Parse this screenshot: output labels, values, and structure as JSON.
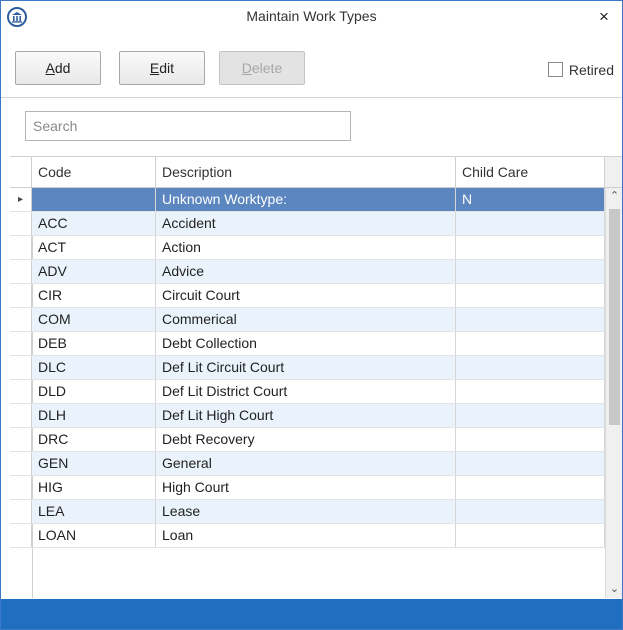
{
  "window": {
    "title": "Maintain Work Types",
    "close_glyph": "×"
  },
  "toolbar": {
    "add": {
      "accel": "A",
      "rest": "dd"
    },
    "edit": {
      "accel": "E",
      "rest": "dit"
    },
    "delete": {
      "accel": "D",
      "rest": "elete"
    },
    "retired_label": "Retired",
    "retired_checked": false
  },
  "search": {
    "placeholder": "Search",
    "value": ""
  },
  "grid": {
    "columns": [
      "Code",
      "Description",
      "Child Care"
    ],
    "row_indicator": "▸",
    "rows": [
      {
        "code": "",
        "description": "Unknown Worktype:",
        "child_care": "N",
        "selected": true
      },
      {
        "code": "ACC",
        "description": "Accident",
        "child_care": ""
      },
      {
        "code": "ACT",
        "description": "Action",
        "child_care": ""
      },
      {
        "code": "ADV",
        "description": "Advice",
        "child_care": ""
      },
      {
        "code": "CIR",
        "description": "Circuit Court",
        "child_care": ""
      },
      {
        "code": "COM",
        "description": "Commerical",
        "child_care": ""
      },
      {
        "code": "DEB",
        "description": "Debt Collection",
        "child_care": ""
      },
      {
        "code": "DLC",
        "description": "Def Lit Circuit Court",
        "child_care": ""
      },
      {
        "code": "DLD",
        "description": "Def Lit District Court",
        "child_care": ""
      },
      {
        "code": "DLH",
        "description": "Def Lit High Court",
        "child_care": ""
      },
      {
        "code": "DRC",
        "description": "Debt Recovery",
        "child_care": ""
      },
      {
        "code": "GEN",
        "description": "General",
        "child_care": ""
      },
      {
        "code": "HIG",
        "description": "High Court",
        "child_care": ""
      },
      {
        "code": "LEA",
        "description": "Lease",
        "child_care": ""
      },
      {
        "code": "LOAN",
        "description": "Loan",
        "child_care": ""
      }
    ]
  },
  "scrollbar": {
    "up_glyph": "⌃",
    "down_glyph": "⌄"
  },
  "colors": {
    "accent": "#1f6ec0",
    "selected_row": "#5b86c0",
    "alt_row": "#eaf3fc"
  }
}
